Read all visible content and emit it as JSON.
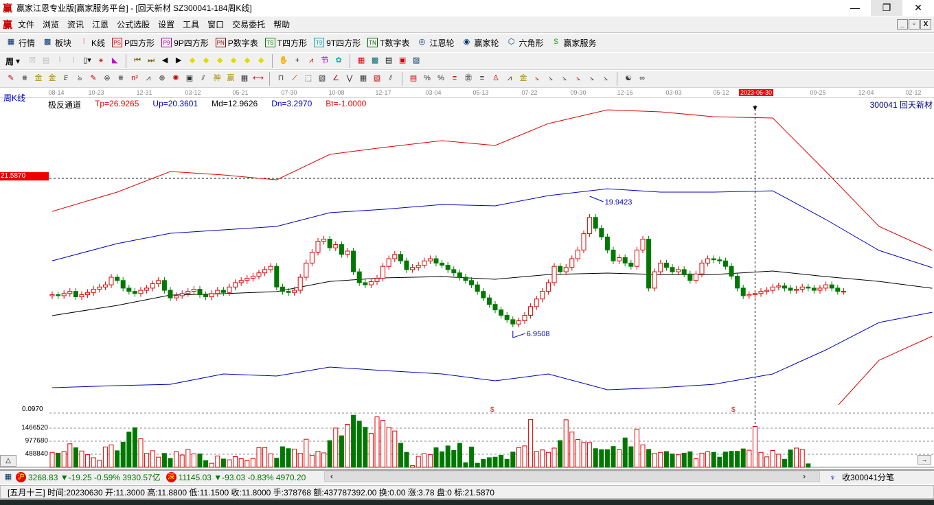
{
  "window": {
    "title": "赢家江恩专业版[赢家服务平台] - [回天新材  SZ300041-184周K线]",
    "logo": "赢"
  },
  "menu": [
    "文件",
    "浏览",
    "资讯",
    "江恩",
    "公式选股",
    "设置",
    "工具",
    "窗口",
    "交易委托",
    "帮助"
  ],
  "toolbar1": [
    {
      "icon": "table-icon",
      "label": "行情"
    },
    {
      "icon": "blocks-icon",
      "label": "板块"
    },
    {
      "icon": "kline-icon",
      "label": "K线"
    },
    {
      "icon": "PS",
      "label": "P四方形"
    },
    {
      "icon": "P9",
      "label": "9P四方形"
    },
    {
      "icon": "PN",
      "label": "P数字表"
    },
    {
      "icon": "TS",
      "label": "T四方形"
    },
    {
      "icon": "T9",
      "label": "9T四方形"
    },
    {
      "icon": "TN",
      "label": "T数字表"
    },
    {
      "icon": "wheel-icon",
      "label": "江恩轮"
    },
    {
      "icon": "wheel2-icon",
      "label": "赢家轮"
    },
    {
      "icon": "hexagon-icon",
      "label": "六角形"
    },
    {
      "icon": "dollar-icon",
      "label": "赢家服务"
    }
  ],
  "period_selector": "周",
  "axis_dates": [
    "08-14",
    "10-23",
    "12-31",
    "03-12",
    "05-21",
    "07-30",
    "10-08",
    "12-17",
    "03-04",
    "05-13",
    "07-22",
    "09-30",
    "12-16",
    "03-03",
    "05-12",
    "2023-06-30",
    "09-25",
    "12-04",
    "02-12"
  ],
  "chart_header": {
    "period": "周K线",
    "indicator": "极反通道",
    "tp": "Tp=26.9265",
    "up": "Up=20.3601",
    "md": "Md=12.9626",
    "dn": "Dn=3.2970",
    "bt": "Bt=-1.0000",
    "stock": "300041  回天新材"
  },
  "price_tag": "21.5870",
  "volume_labels": [
    "0.0970",
    "1466520",
    "977680",
    "488840"
  ],
  "colors": {
    "up": "#e00000",
    "down": "#007800",
    "upper_band": "#e00000",
    "mid_band": "#0000c8",
    "center": "#000000"
  },
  "chart_data": {
    "type": "candlestick",
    "high_label": "19.9423",
    "low_label": "6.9508",
    "high_value": 19.9423,
    "low_value": 6.9508,
    "crosshair_price": 21.587,
    "crosshair_index": 119,
    "closes": [
      10.9,
      10.8,
      11.0,
      11.2,
      10.7,
      10.9,
      11.1,
      11.4,
      11.6,
      11.8,
      12.5,
      12.2,
      11.5,
      11.2,
      11.0,
      11.3,
      11.5,
      11.9,
      12.2,
      11.3,
      10.6,
      10.8,
      11.0,
      11.2,
      11.4,
      10.9,
      10.7,
      11.0,
      11.3,
      11.1,
      11.6,
      12.0,
      12.2,
      12.4,
      12.6,
      12.9,
      13.2,
      13.5,
      11.6,
      11.2,
      11.1,
      11.3,
      12.5,
      13.8,
      14.8,
      15.8,
      16.0,
      15.2,
      15.5,
      14.6,
      14.9,
      13.0,
      12.0,
      11.8,
      12.1,
      12.4,
      13.5,
      14.2,
      14.6,
      14.0,
      13.2,
      13.4,
      13.6,
      14.0,
      14.2,
      13.8,
      13.6,
      13.2,
      12.9,
      12.5,
      12.2,
      11.8,
      11.2,
      10.6,
      10.0,
      9.5,
      9.0,
      8.6,
      8.2,
      8.5,
      9.0,
      9.8,
      10.5,
      11.2,
      12.0,
      13.5,
      13.0,
      13.4,
      14.2,
      15.0,
      16.5,
      18.0,
      17.0,
      16.2,
      15.0,
      14.0,
      14.3,
      13.8,
      13.5,
      15.0,
      16.0,
      11.5,
      13.0,
      13.8,
      13.4,
      13.0,
      13.2,
      12.8,
      12.2,
      12.8,
      13.8,
      14.2,
      14.1,
      14.0,
      13.5,
      12.6,
      11.5,
      10.8,
      10.9,
      11.0,
      11.2,
      11.3,
      11.6,
      11.7,
      11.5,
      11.3,
      11.4,
      11.6,
      11.5,
      11.3,
      11.5,
      11.8,
      11.5,
      11.2,
      11.2
    ],
    "volumes_k": [
      560,
      530,
      590,
      880,
      730,
      610,
      480,
      360,
      260,
      760,
      840,
      620,
      940,
      1320,
      1480,
      1070,
      520,
      620,
      380,
      520,
      330,
      580,
      460,
      670,
      500,
      500,
      250,
      150,
      420,
      310,
      280,
      400,
      320,
      250,
      330,
      740,
      740,
      500,
      340,
      770,
      700,
      680,
      520,
      1050,
      450,
      600,
      540,
      1000,
      1470,
      1180,
      1610,
      1950,
      1730,
      1500,
      1270,
      1890,
      1760,
      1500,
      1360,
      900,
      560,
      60,
      410,
      510,
      480,
      730,
      580,
      800,
      630,
      900,
      170,
      760,
      150,
      300,
      360,
      380,
      450,
      300,
      570,
      740,
      800,
      1790,
      590,
      650,
      560,
      720,
      1000,
      1780,
      1320,
      1040,
      930,
      930,
      700,
      660,
      660,
      780,
      660,
      1100,
      770,
      1430,
      840,
      670,
      520,
      560,
      590,
      500,
      470,
      530,
      580,
      320,
      530,
      580,
      560,
      380,
      570,
      600,
      600,
      690,
      640,
      1530,
      560,
      390,
      630,
      490,
      300,
      650,
      720,
      670,
      130
    ],
    "bands": {
      "sample_index": [
        0,
        11,
        20,
        29,
        38,
        47,
        56,
        66,
        75,
        84,
        94,
        103,
        112,
        122,
        131,
        140,
        149
      ],
      "upper_outer": [
        18.55,
        20.32,
        22.21,
        21.9,
        21.45,
        23.79,
        24.42,
        25.05,
        24.61,
        26.62,
        27.88,
        27.7,
        27.25,
        27.13,
        22.21,
        17.17,
        14.96
      ],
      "upper": [
        14.01,
        15.59,
        16.54,
        16.85,
        17.17,
        18.43,
        18.74,
        19.18,
        19.06,
        20.0,
        20.63,
        20.32,
        20.32,
        20.44,
        17.8,
        14.96,
        13.38
      ],
      "center": [
        8.97,
        9.91,
        10.86,
        10.99,
        11.18,
        12.12,
        12.44,
        12.56,
        12.31,
        12.75,
        12.88,
        12.75,
        12.75,
        13.07,
        12.56,
        12.12,
        11.49
      ],
      "lower": [
        2.35,
        2.54,
        2.66,
        3.61,
        3.42,
        4.24,
        3.93,
        3.61,
        2.98,
        3.61,
        2.16,
        2.35,
        2.66,
        3.61,
        5.82,
        8.34,
        9.28
      ],
      "lower_outer": [
        -30,
        -30,
        -30,
        -30,
        -30,
        -30,
        -30,
        -30,
        -30,
        -30,
        -30,
        -30,
        -30,
        -30,
        -0.49,
        4.87,
        7.08
      ]
    }
  },
  "index_bar": {
    "sh_badge": "沪",
    "sh": "3268.83 ▼-19.25 -0.59% 3930.57亿",
    "sz_badge": "深",
    "sz": "11145.03 ▼-93.03 -0.83% 4970.20",
    "tick_label": "收300041分笔"
  },
  "status": "[五月十三] 时间:20230630 开:11.3000 高:11.8800 低:11.1500 收:11.8000 手:378768 额:437787392.00 换:0.00 涨:3.78 盘:0 标:21.5870"
}
